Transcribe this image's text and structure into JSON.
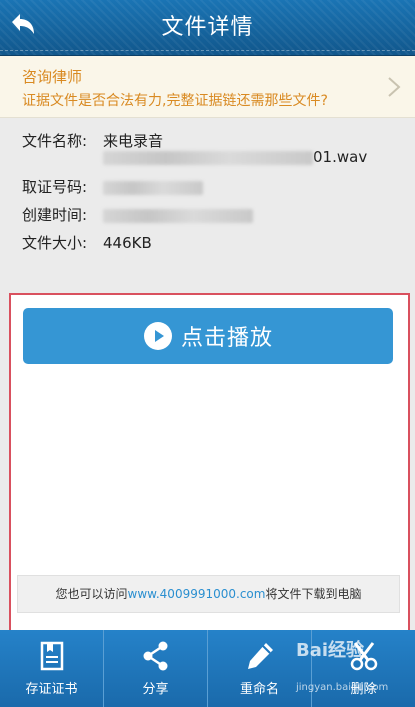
{
  "header": {
    "title": "文件详情",
    "back_icon": "back-arrow-icon"
  },
  "consult": {
    "title": "咨询律师",
    "subtitle": "证据文件是否合法有力,完整证据链还需那些文件?",
    "arrow_icon": "chevron-right-icon"
  },
  "details": {
    "filename_label": "文件名称:",
    "filename_value": "来电录音",
    "filename_suffix": "01.wav",
    "evidence_no_label": "取证号码:",
    "created_label": "创建时间:",
    "size_label": "文件大小:",
    "size_value": "446KB"
  },
  "player": {
    "play_label": "点击播放",
    "play_icon": "play-circle-icon"
  },
  "notice": {
    "prefix": "您也可以访问",
    "link": "www.4009991000.com",
    "suffix": "将文件下载到电脑"
  },
  "toolbar": {
    "items": [
      {
        "label": "存证证书",
        "icon": "certificate-icon"
      },
      {
        "label": "分享",
        "icon": "share-icon"
      },
      {
        "label": "重命名",
        "icon": "pencil-icon"
      },
      {
        "label": "删除",
        "icon": "scissors-icon"
      }
    ]
  },
  "watermark": {
    "text": "Bai经验",
    "sub": "jingyan.baidu.com"
  },
  "colors": {
    "header": "#1565a0",
    "accent": "#3596d4",
    "consult_text": "#d98a22",
    "highlight_border": "#d9505e"
  }
}
